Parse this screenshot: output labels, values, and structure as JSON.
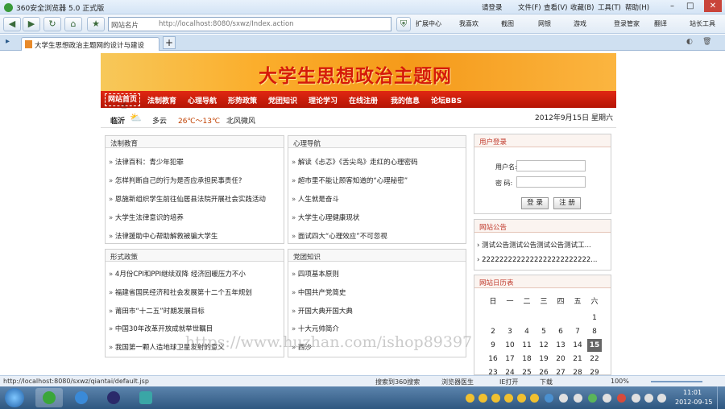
{
  "browser": {
    "title": "360安全浏览器 5.0 正式版",
    "menu": [
      "请登录",
      "文件(F)",
      "查看(V)",
      "收藏(B)",
      "工具(T)",
      "帮助(H)"
    ],
    "address_label": "网站名片",
    "url": "http://localhost:8080/sxwz/Index.action",
    "toolbar": [
      "扩展中心",
      "我喜欢",
      "截图",
      "网银",
      "游戏",
      "登录管家",
      "翻译",
      "站长工具"
    ],
    "tab_title": "大学生思想政治主题网的设计与建设"
  },
  "site": {
    "banner_title": "大学生思想政治主题网",
    "nav": [
      "网站首页",
      "法制教育",
      "心理导航",
      "形势政策",
      "党团知识",
      "理论学习",
      "在线注册",
      "我的信息",
      "论坛BBS"
    ],
    "weather": {
      "city": "临沂",
      "condition": "多云",
      "temp": "26℃～13℃",
      "wind": "北风微风"
    },
    "date": "2012年9月15日 星期六"
  },
  "panels": {
    "law": {
      "title": "法制教育",
      "items": [
        "法律百科：青少年犯罪",
        "怎样判断自己的行为是否应承担民事责任?",
        "恩施新组织学生前往仙居县法院开展社会实践活动",
        "大学生法律意识的培养",
        "法律援助中心帮助解救被骗大学生"
      ]
    },
    "psy": {
      "title": "心理导航",
      "items": [
        "解读《忐忑》《舌尖鸟》走红的心理密码",
        "超市里不能让顾客知道的“心理秘密”",
        "人生就是奋斗",
        "大学生心理健康现状",
        "面试四大“心理效应”不可忽视"
      ]
    },
    "policy": {
      "title": "形式政策",
      "items": [
        "4月份CPI和PPI继续双降 经济回暖压力不小",
        "福建省国民经济和社会发展第十二个五年规划",
        "莆田市“十二五”时期发展目标",
        "中国30年改革开放成就举世瞩目",
        "我国第一颗人造地球卫星发射的意义"
      ]
    },
    "party": {
      "title": "党团知识",
      "items": [
        "四项基本原则",
        "中国共产党简史",
        "开国大典开国大典",
        "十大元帅简介",
        "西沙"
      ]
    }
  },
  "sidebar": {
    "login": {
      "title": "用户登录",
      "user_label": "用户名:",
      "pass_label": "密  码:",
      "login_btn": "登 录",
      "register_btn": "注 册"
    },
    "notice": {
      "title": "网站公告",
      "items": [
        "测试公告测试公告测试公告测试工...",
        "2222222222222222222222222..."
      ]
    },
    "calendar": {
      "title": "网站日历表",
      "weekdays": [
        "日",
        "一",
        "二",
        "三",
        "四",
        "五",
        "六"
      ],
      "today": "15",
      "rows": [
        [
          "",
          "",
          "",
          "",
          "",
          "",
          "1"
        ],
        [
          "2",
          "3",
          "4",
          "5",
          "6",
          "7",
          "8"
        ],
        [
          "9",
          "10",
          "11",
          "12",
          "13",
          "14",
          "15"
        ],
        [
          "16",
          "17",
          "18",
          "19",
          "20",
          "21",
          "22"
        ],
        [
          "23",
          "24",
          "25",
          "26",
          "27",
          "28",
          "29"
        ]
      ]
    }
  },
  "status": {
    "url": "http://localhost:8080/sxwz/qiantai/default.jsp",
    "search": "搜索到360搜索",
    "doctor": "浏览器医生",
    "open": "IE打开",
    "download": "下载",
    "zoom": "100%"
  },
  "taskbar": {
    "time": "11:01",
    "date": "2012-09-15"
  },
  "watermark": "https://www.huzhan.com/ishop89397"
}
